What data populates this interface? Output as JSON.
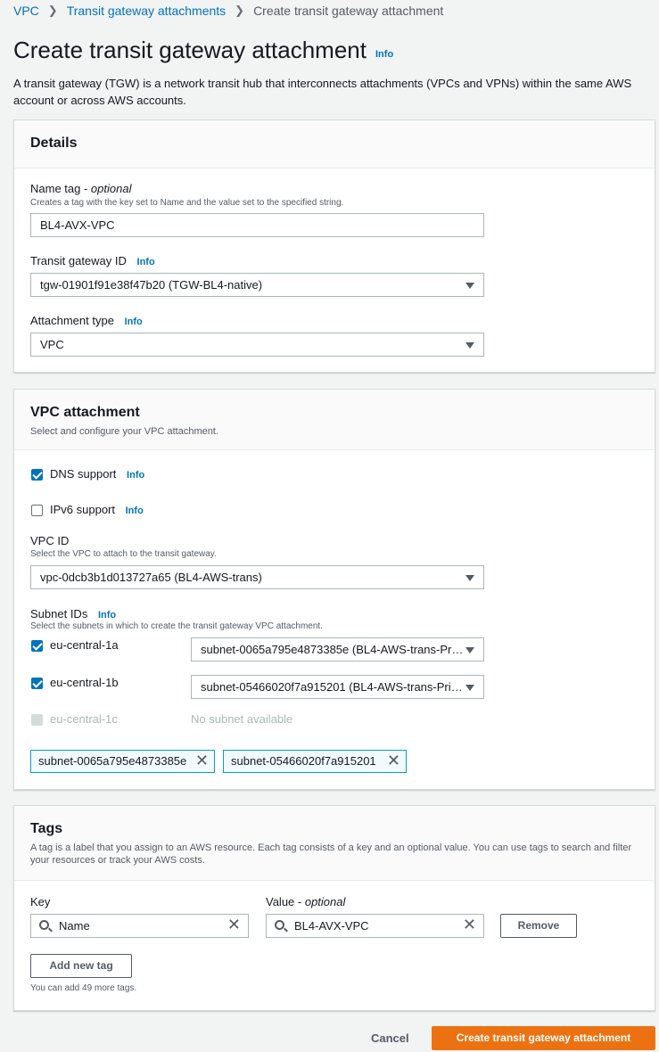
{
  "breadcrumb": {
    "root": "VPC",
    "parent": "Transit gateway attachments",
    "current": "Create transit gateway attachment"
  },
  "page": {
    "title": "Create transit gateway attachment",
    "info": "Info",
    "description": "A transit gateway (TGW) is a network transit hub that interconnects attachments (VPCs and VPNs) within the same AWS account or across AWS accounts."
  },
  "details": {
    "heading": "Details",
    "name_tag_label": "Name tag - ",
    "name_tag_optional": "optional",
    "name_tag_hint": "Creates a tag with the key set to Name and the value set to the specified string.",
    "name_tag_value": "BL4-AVX-VPC",
    "tgw_label": "Transit gateway ID",
    "tgw_info": "Info",
    "tgw_value": "tgw-01901f91e38f47b20 (TGW-BL4-native)",
    "type_label": "Attachment type",
    "type_info": "Info",
    "type_value": "VPC"
  },
  "vpc_attachment": {
    "heading": "VPC attachment",
    "subtitle": "Select and configure your VPC attachment.",
    "dns_label": "DNS support",
    "dns_info": "Info",
    "dns_checked": true,
    "ipv6_label": "IPv6 support",
    "ipv6_info": "Info",
    "ipv6_checked": false,
    "vpc_id_label": "VPC ID",
    "vpc_id_hint": "Select the VPC to attach to the transit gateway.",
    "vpc_id_value": "vpc-0dcb3b1d013727a65 (BL4-AWS-trans)",
    "subnet_label": "Subnet IDs",
    "subnet_info": "Info",
    "subnet_hint": "Select the subnets in which to create the transit gateway VPC attachment.",
    "subnets": [
      {
        "az": "eu-central-1a",
        "checked": true,
        "value": "subnet-0065a795e4873385e (BL4-AWS-trans-Pr…"
      },
      {
        "az": "eu-central-1b",
        "checked": true,
        "value": "subnet-05466020f7a915201 (BL4-AWS-trans-Pri…"
      },
      {
        "az": "eu-central-1c",
        "checked": false,
        "disabled": true,
        "value": "No subnet available"
      }
    ],
    "tokens": [
      "subnet-0065a795e4873385e",
      "subnet-05466020f7a915201"
    ]
  },
  "tags": {
    "heading": "Tags",
    "subtitle": "A tag is a label that you assign to an AWS resource. Each tag consists of a key and an optional value. You can use tags to search and filter your resources or track your AWS costs.",
    "key_label": "Key",
    "value_label": "Value - ",
    "value_optional": "optional",
    "key_value": "Name",
    "value_value": "BL4-AVX-VPC",
    "remove_label": "Remove",
    "add_label": "Add new tag",
    "remaining": "You can add 49 more tags."
  },
  "footer": {
    "cancel": "Cancel",
    "create": "Create transit gateway attachment"
  },
  "colors": {
    "accent": "#0073bb",
    "primary": "#ec7211",
    "token_border": "#00a1c9"
  }
}
